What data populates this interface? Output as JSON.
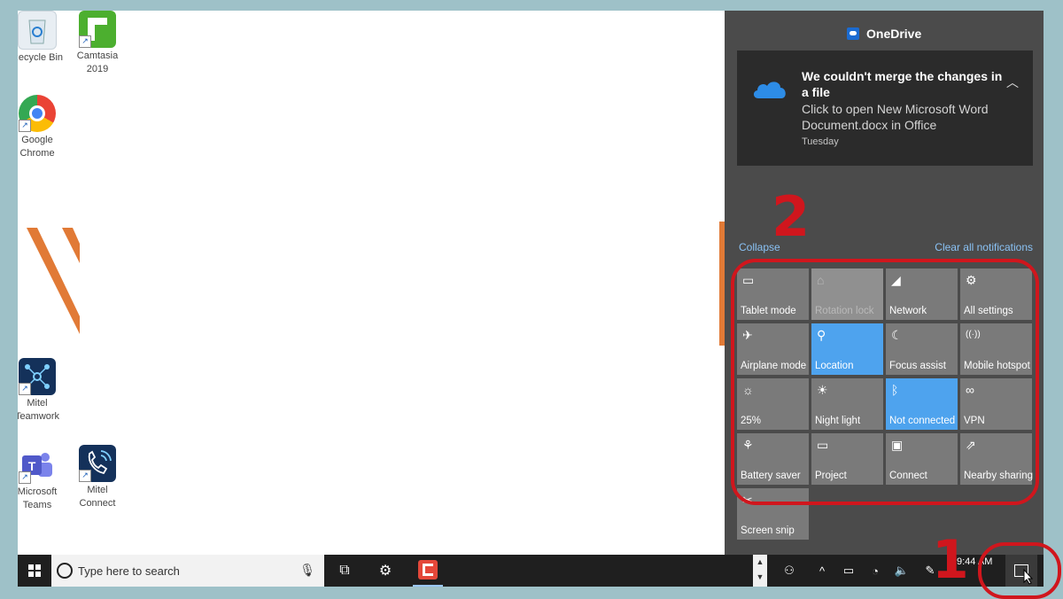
{
  "desktop": {
    "icons": [
      {
        "line1": "Recycle Bin",
        "line2": ""
      },
      {
        "line1": "Camtasia",
        "line2": "2019"
      },
      {
        "line1": "Google",
        "line2": "Chrome"
      },
      {
        "line1": "Mitel",
        "line2": "Teamwork"
      },
      {
        "line1": "Microsoft",
        "line2": "Teams"
      },
      {
        "line1": "Mitel",
        "line2": "Connect"
      }
    ]
  },
  "action_center": {
    "app_title": "OneDrive",
    "notification": {
      "title": "We couldn't merge the changes in a file",
      "body": "Click to open New Microsoft Word Document.docx in Office",
      "time": "Tuesday"
    },
    "collapse_label": "Collapse",
    "clear_label": "Clear all notifications",
    "tiles": [
      {
        "label": "Tablet mode",
        "icon": "tablet-icon",
        "state": "off",
        "glyph": "▭"
      },
      {
        "label": "Rotation lock",
        "icon": "rotation-lock-icon",
        "state": "disabled",
        "glyph": "⌂"
      },
      {
        "label": "Network",
        "icon": "network-icon",
        "state": "off",
        "glyph": "◢"
      },
      {
        "label": "All settings",
        "icon": "settings-icon",
        "state": "off",
        "glyph": "⚙"
      },
      {
        "label": "Airplane mode",
        "icon": "airplane-icon",
        "state": "off",
        "glyph": "✈"
      },
      {
        "label": "Location",
        "icon": "location-icon",
        "state": "on",
        "glyph": "⚲"
      },
      {
        "label": "Focus assist",
        "icon": "moon-icon",
        "state": "off",
        "glyph": "☾"
      },
      {
        "label": "Mobile hotspot",
        "icon": "hotspot-icon",
        "state": "off",
        "glyph": "((·))"
      },
      {
        "label": "25%",
        "icon": "brightness-icon",
        "state": "off",
        "glyph": "☼"
      },
      {
        "label": "Night light",
        "icon": "night-light-icon",
        "state": "off",
        "glyph": "☀"
      },
      {
        "label": "Not connected",
        "icon": "bluetooth-icon",
        "state": "on",
        "glyph": "ᛒ"
      },
      {
        "label": "VPN",
        "icon": "vpn-icon",
        "state": "off",
        "glyph": "∞"
      },
      {
        "label": "Battery saver",
        "icon": "battery-saver-icon",
        "state": "off",
        "glyph": "⚘"
      },
      {
        "label": "Project",
        "icon": "project-icon",
        "state": "off",
        "glyph": "▭"
      },
      {
        "label": "Connect",
        "icon": "connect-icon",
        "state": "off",
        "glyph": "▣"
      },
      {
        "label": "Nearby sharing",
        "icon": "share-icon",
        "state": "off",
        "glyph": "⇗"
      },
      {
        "label": "Screen snip",
        "icon": "snip-icon",
        "state": "off",
        "glyph": "✂"
      }
    ]
  },
  "taskbar": {
    "search_placeholder": "Type here to search",
    "clock": "9:44 AM"
  },
  "annotations": {
    "label_1": "1",
    "label_2": "2"
  },
  "colors": {
    "accent": "#4ea3ee",
    "annotation": "#d0161d",
    "action_center_bg": "#4b4b4b"
  }
}
